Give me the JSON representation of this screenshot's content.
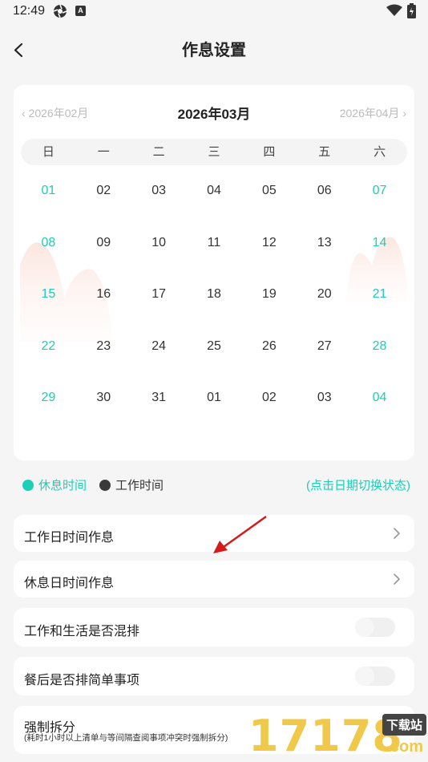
{
  "status_bar": {
    "time": "12:49",
    "icons": [
      "aperture-icon",
      "a-icon",
      "wifi-icon",
      "battery-icon"
    ]
  },
  "header": {
    "title": "作息设置",
    "back_icon": "chevron-left-icon"
  },
  "calendar": {
    "prev_month": "2026年02月",
    "current_month": "2026年03月",
    "next_month": "2026年04月",
    "weekdays": [
      "日",
      "一",
      "二",
      "三",
      "四",
      "五",
      "六"
    ],
    "days": [
      {
        "label": "01",
        "rest": true
      },
      {
        "label": "02",
        "rest": false
      },
      {
        "label": "03",
        "rest": false
      },
      {
        "label": "04",
        "rest": false
      },
      {
        "label": "05",
        "rest": false
      },
      {
        "label": "06",
        "rest": false
      },
      {
        "label": "07",
        "rest": true
      },
      {
        "label": "08",
        "rest": true
      },
      {
        "label": "09",
        "rest": false
      },
      {
        "label": "10",
        "rest": false
      },
      {
        "label": "11",
        "rest": false
      },
      {
        "label": "12",
        "rest": false
      },
      {
        "label": "13",
        "rest": false
      },
      {
        "label": "14",
        "rest": true
      },
      {
        "label": "15",
        "rest": true
      },
      {
        "label": "16",
        "rest": false
      },
      {
        "label": "17",
        "rest": false
      },
      {
        "label": "18",
        "rest": false
      },
      {
        "label": "19",
        "rest": false
      },
      {
        "label": "20",
        "rest": false
      },
      {
        "label": "21",
        "rest": true
      },
      {
        "label": "22",
        "rest": true
      },
      {
        "label": "23",
        "rest": false
      },
      {
        "label": "24",
        "rest": false
      },
      {
        "label": "25",
        "rest": false
      },
      {
        "label": "26",
        "rest": false
      },
      {
        "label": "27",
        "rest": false
      },
      {
        "label": "28",
        "rest": true
      },
      {
        "label": "29",
        "rest": true
      },
      {
        "label": "30",
        "rest": false
      },
      {
        "label": "31",
        "rest": false
      },
      {
        "label": "01",
        "rest": false
      },
      {
        "label": "02",
        "rest": false
      },
      {
        "label": "03",
        "rest": false
      },
      {
        "label": "04",
        "rest": true
      }
    ]
  },
  "legend": {
    "rest_label": "休息时间",
    "work_label": "工作时间",
    "hint": "(点击日期切换状态)"
  },
  "settings": {
    "workday_schedule": "工作日时间作息",
    "restday_schedule": "休息日时间作息",
    "mixed_label": "工作和生活是否混排",
    "mixed_enabled": false,
    "after_meal_label": "餐后是否排简单事项",
    "after_meal_enabled": false,
    "force_split_label": "强制拆分",
    "force_split_desc": "(耗时1小时以上清单与等间隔查阅事项冲突时强制拆分)"
  },
  "colors": {
    "accent": "#1ccfb5",
    "work_dot": "#3a3a3a",
    "background": "#f5f5f5"
  },
  "watermark": {
    "number": "17178",
    "badge": "下载站",
    "suffix": ".com"
  }
}
